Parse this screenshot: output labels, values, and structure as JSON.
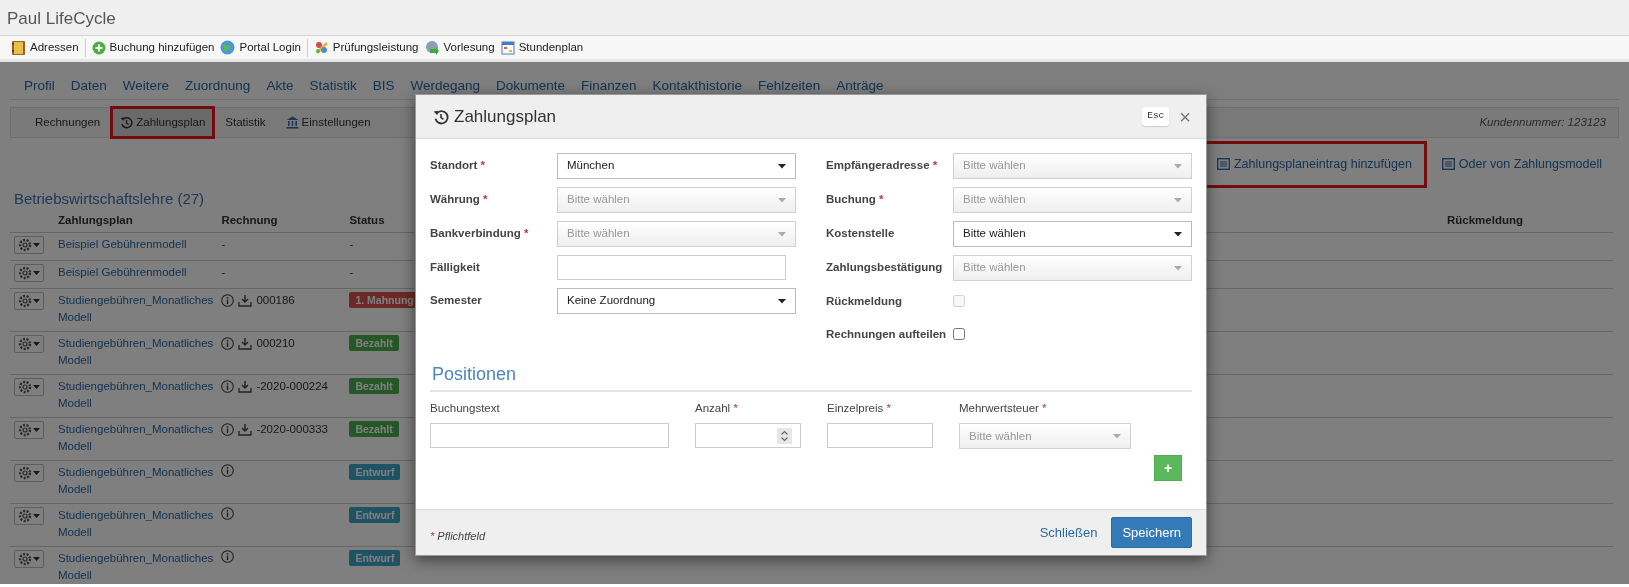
{
  "app_title": "Paul LifeCycle",
  "toolbar_groups": [
    [
      {
        "label": "Adressen"
      }
    ],
    [
      {
        "label": "Buchung hinzufügen"
      },
      {
        "label": "Portal Login"
      }
    ],
    [
      {
        "label": "Prüfungsleistung"
      },
      {
        "label": "Vorlesung"
      },
      {
        "label": "Stundenplan"
      }
    ]
  ],
  "main_tabs": [
    "Profil",
    "Daten",
    "Weitere",
    "Zuordnung",
    "Akte",
    "Statistik",
    "BIS",
    "Werdegang",
    "Dokumente",
    "Finanzen",
    "Kontakthistorie",
    "Fehlzeiten",
    "Anträge"
  ],
  "sub_tabs": [
    {
      "label": "Rechnungen",
      "selected": false,
      "highlighted": false
    },
    {
      "label": "Zahlungsplan",
      "selected": true,
      "highlighted": true
    },
    {
      "label": "Statistik",
      "selected": false,
      "highlighted": false
    },
    {
      "label": "Einstellungen",
      "selected": false,
      "highlighted": false
    }
  ],
  "customer_number": "Kundennummer: 123123",
  "actions": [
    {
      "label": "Zahlungsplaneintrag hinzufügen",
      "highlighted": true
    },
    {
      "label": "Oder von Zahlungsmodell",
      "highlighted": false
    }
  ],
  "section_title": "Betriebswirtschaftslehre (27)",
  "table": {
    "columns": [
      "Zahlungsplan",
      "Rechnung",
      "Status",
      "Rückmeldung"
    ],
    "rows": [
      {
        "plan": "Beispiel Gebührenmodell",
        "info": false,
        "download": false,
        "invoice": "-",
        "status": "-",
        "kind": "text"
      },
      {
        "plan": "Beispiel Gebührenmodell",
        "info": false,
        "download": false,
        "invoice": "-",
        "status": "-",
        "kind": "text"
      },
      {
        "plan": "Studiengebühren_Monatliches Modell",
        "info": true,
        "download": true,
        "invoice": "000186",
        "status": "1. Mahnung",
        "kind": "danger"
      },
      {
        "plan": "Studiengebühren_Monatliches Modell",
        "info": true,
        "download": true,
        "invoice": "000210",
        "status": "Bezahlt",
        "kind": "success"
      },
      {
        "plan": "Studiengebühren_Monatliches Modell",
        "info": true,
        "download": true,
        "invoice": "-2020-000224",
        "status": "Bezahlt",
        "kind": "success"
      },
      {
        "plan": "Studiengebühren_Monatliches Modell",
        "info": true,
        "download": true,
        "invoice": "-2020-000333",
        "status": "Bezahlt",
        "kind": "success"
      },
      {
        "plan": "Studiengebühren_Monatliches Modell",
        "info": true,
        "download": false,
        "status": "Entwurf",
        "kind": "info"
      },
      {
        "plan": "Studiengebühren_Monatliches Modell",
        "info": true,
        "download": false,
        "status": "Entwurf",
        "kind": "info"
      },
      {
        "plan": "Studiengebühren_Monatliches Modell",
        "info": true,
        "download": false,
        "status": "Entwurf",
        "kind": "info"
      }
    ]
  },
  "modal": {
    "title": "Zahlungsplan",
    "esc": "Esc",
    "close": "×",
    "left_fields": [
      {
        "label": "Standort",
        "mark": "*",
        "kind": "select",
        "value": "München"
      },
      {
        "label": "Währung",
        "mark": "*",
        "kind": "select",
        "placeholder": "Bitte wählen"
      },
      {
        "label": "Bankverbindung",
        "mark": "*",
        "kind": "select",
        "placeholder": "Bitte wählen"
      },
      {
        "label": "Fälligkeit",
        "kind": "text"
      },
      {
        "label": "Semester",
        "kind": "select",
        "value": "Keine Zuordnung"
      }
    ],
    "right_fields": [
      {
        "label": "Empfängeradresse",
        "mark": "*",
        "kind": "select",
        "placeholder": "Bitte wählen"
      },
      {
        "label": "Buchung",
        "mark": "*",
        "kind": "select",
        "placeholder": "Bitte wählen"
      },
      {
        "label": "Kostenstelle",
        "kind": "select",
        "value": "Bitte wählen"
      },
      {
        "label": "Zahlungsbestätigung",
        "kind": "select",
        "placeholder": "Bitte wählen"
      },
      {
        "label": "Rückmeldung",
        "kind": "checkbox",
        "checked": false,
        "disabled": true
      },
      {
        "label": "Rechnungen aufteilen",
        "kind": "checkbox",
        "checked": false,
        "disabled": false
      }
    ],
    "positions_title": "Positionen",
    "position_fields": [
      {
        "label": "Buchungstext",
        "kind": "text"
      },
      {
        "label": "Anzahl",
        "mark": "*",
        "kind": "number"
      },
      {
        "label": "Einzelpreis",
        "mark": "*",
        "kind": "text"
      },
      {
        "label": "Mehrwertsteuer",
        "mark": "*",
        "kind": "select",
        "placeholder": "Bitte wählen"
      }
    ],
    "add_label": "+",
    "footnote": {
      "mark": "*",
      "text": "Pflichtfeld"
    },
    "buttons": [
      {
        "label": "Schließen",
        "kind": "link"
      },
      {
        "label": "Speichern",
        "kind": "primary"
      }
    ]
  }
}
